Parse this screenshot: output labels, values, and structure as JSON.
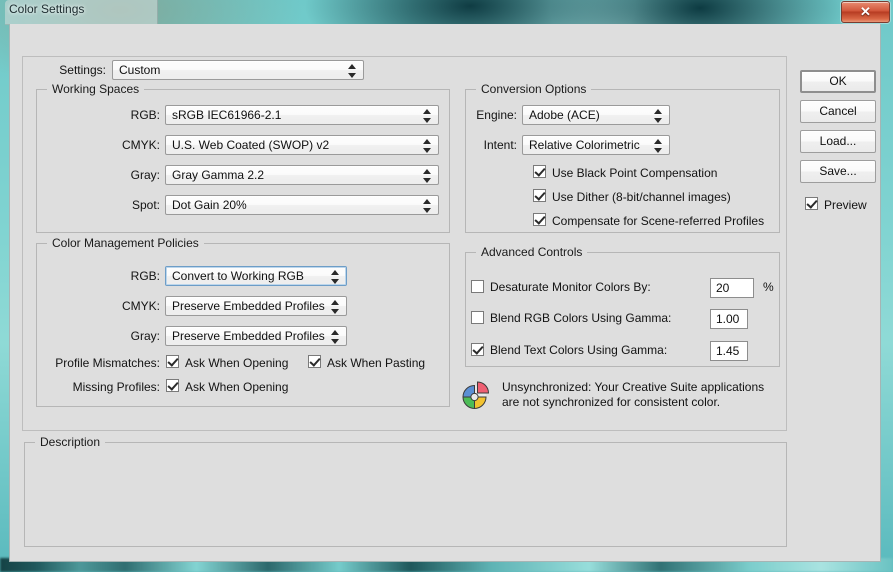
{
  "window": {
    "title": "Color Settings",
    "close_label": "✕"
  },
  "settings_row": {
    "label": "Settings:",
    "value": "Custom"
  },
  "working_spaces": {
    "legend": "Working Spaces",
    "rows": [
      {
        "label": "RGB:",
        "value": "sRGB IEC61966-2.1"
      },
      {
        "label": "CMYK:",
        "value": "U.S. Web Coated (SWOP) v2"
      },
      {
        "label": "Gray:",
        "value": "Gray Gamma 2.2"
      },
      {
        "label": "Spot:",
        "value": "Dot Gain 20%"
      }
    ]
  },
  "color_management_policies": {
    "legend": "Color Management Policies",
    "rows": [
      {
        "label": "RGB:",
        "value": "Convert to Working RGB"
      },
      {
        "label": "CMYK:",
        "value": "Preserve Embedded Profiles"
      },
      {
        "label": "Gray:",
        "value": "Preserve Embedded Profiles"
      }
    ],
    "profile_mismatches_label": "Profile Mismatches:",
    "mismatch_open_label": "Ask When Opening",
    "mismatch_paste_label": "Ask When Pasting",
    "missing_profiles_label": "Missing Profiles:",
    "missing_open_label": "Ask When Opening",
    "mismatch_open_checked": true,
    "mismatch_paste_checked": true,
    "missing_open_checked": true
  },
  "conversion_options": {
    "legend": "Conversion Options",
    "engine_label": "Engine:",
    "engine_value": "Adobe (ACE)",
    "intent_label": "Intent:",
    "intent_value": "Relative Colorimetric",
    "checks": [
      {
        "label": "Use Black Point Compensation",
        "checked": true
      },
      {
        "label": "Use Dither (8-bit/channel images)",
        "checked": true
      },
      {
        "label": "Compensate for Scene-referred Profiles",
        "checked": true
      }
    ]
  },
  "advanced_controls": {
    "legend": "Advanced Controls",
    "rows": [
      {
        "label": "Desaturate Monitor Colors By:",
        "checked": false,
        "value": "20",
        "suffix": "%"
      },
      {
        "label": "Blend RGB Colors Using Gamma:",
        "checked": false,
        "value": "1.00",
        "suffix": ""
      },
      {
        "label": "Blend Text Colors Using Gamma:",
        "checked": true,
        "value": "1.45",
        "suffix": ""
      }
    ]
  },
  "sync_status": {
    "line1": "Unsynchronized: Your Creative Suite applications",
    "line2": "are not synchronized for consistent color.",
    "icon": "color-wheel-icon"
  },
  "description": {
    "legend": "Description",
    "text": ""
  },
  "buttons": {
    "ok": "OK",
    "cancel": "Cancel",
    "load": "Load...",
    "save": "Save...",
    "preview_label": "Preview",
    "preview_checked": true
  }
}
